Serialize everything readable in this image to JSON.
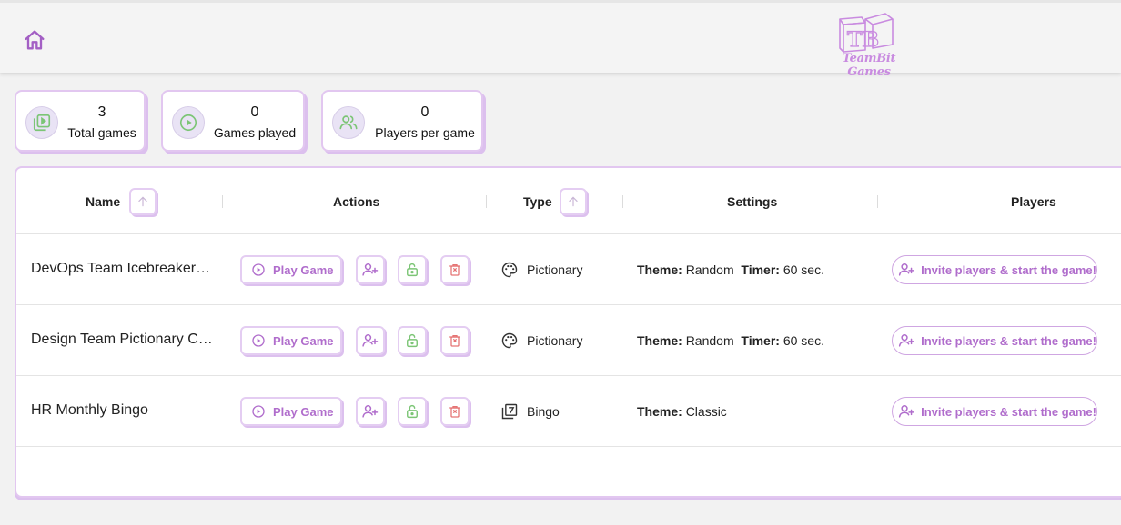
{
  "brand": {
    "logo_letters": "TB",
    "name": "TeamBit Games"
  },
  "colors": {
    "accent": "#b06dcc",
    "border": "#e2c7f0",
    "green": "#7cc576",
    "red": "#e57373"
  },
  "stats": [
    {
      "value": "3",
      "label": "Total games",
      "icon": "video-library-icon"
    },
    {
      "value": "0",
      "label": "Games played",
      "icon": "play-circle-icon"
    },
    {
      "value": "0",
      "label": "Players per game",
      "icon": "group-icon"
    }
  ],
  "table": {
    "headers": {
      "name": "Name",
      "actions": "Actions",
      "type": "Type",
      "settings": "Settings",
      "players": "Players"
    },
    "rows": [
      {
        "name": "DevOps Team Icebreaker Pictionary",
        "play_label": "Play Game",
        "type": "Pictionary",
        "type_icon": "palette-icon",
        "theme_label": "Theme:",
        "theme": "Random",
        "timer_label": "Timer:",
        "timer": "60 sec.",
        "invite_label": "Invite players & start the game!"
      },
      {
        "name": "Design Team Pictionary Challenge",
        "play_label": "Play Game",
        "type": "Pictionary",
        "type_icon": "palette-icon",
        "theme_label": "Theme:",
        "theme": "Random",
        "timer_label": "Timer:",
        "timer": "60 sec.",
        "invite_label": "Invite players & start the game!"
      },
      {
        "name": "HR Monthly Bingo",
        "play_label": "Play Game",
        "type": "Bingo",
        "type_icon": "bingo-card-icon",
        "theme_label": "Theme:",
        "theme": "Classic",
        "timer_label": "",
        "timer": "",
        "invite_label": "Invite players & start the game!"
      }
    ]
  }
}
